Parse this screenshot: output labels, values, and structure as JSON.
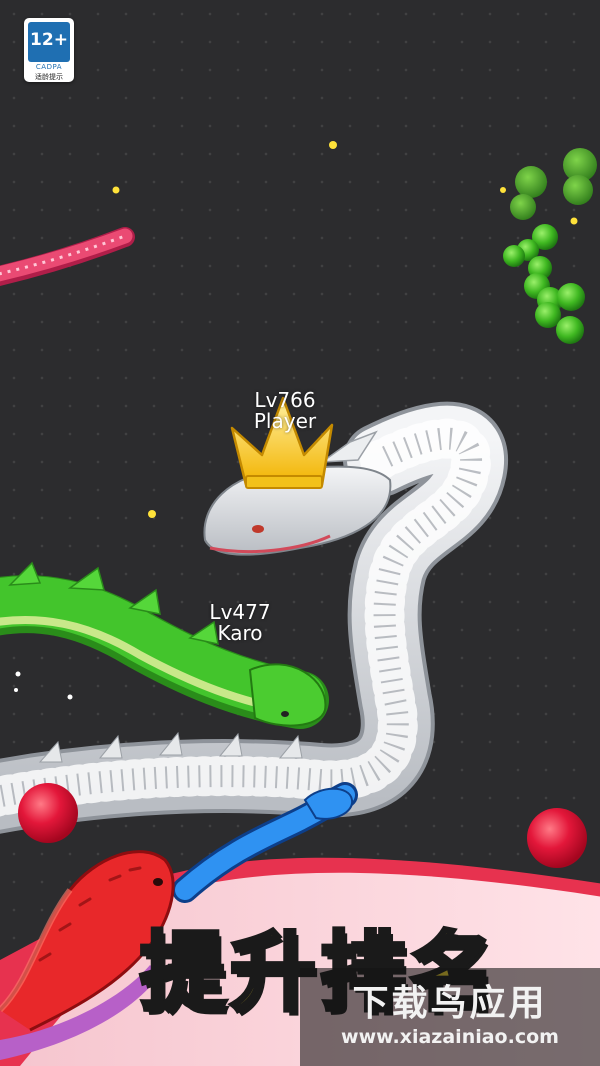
{
  "age_rating": {
    "label": "12+",
    "org": "CADPA",
    "tip": "适龄提示"
  },
  "players": [
    {
      "level": "Lv766",
      "name": "Player"
    },
    {
      "level": "Lv477",
      "name": "Karo"
    }
  ],
  "banner": {
    "text": "提升排名"
  },
  "watermark": {
    "name": "下载鸟应用",
    "url": "www.xiazainiao.com"
  },
  "colors": {
    "background": "#2c2c2e",
    "player_snake": "#d9dce0",
    "karo_snake": "#3fc12a",
    "pink_snake": "#e8486e",
    "red_snake": "#e8282a",
    "blue_snake": "#2c8ef0",
    "crown": "#ffcc1f",
    "banner_text": "#ffe02b",
    "red_orb": "#e0193a",
    "green_orb": "#46c22a"
  },
  "icons": [
    "crown-icon",
    "age-rating-icon"
  ]
}
